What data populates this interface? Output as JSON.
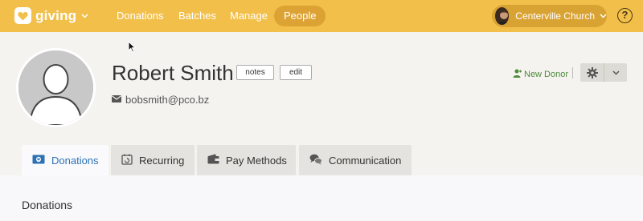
{
  "app": {
    "name": "giving"
  },
  "nav": {
    "items": [
      {
        "label": "Donations",
        "active": false
      },
      {
        "label": "Batches",
        "active": false
      },
      {
        "label": "Manage",
        "active": false
      },
      {
        "label": "People",
        "active": true
      }
    ]
  },
  "org": {
    "name": "Centerville Church"
  },
  "help": {
    "symbol": "?"
  },
  "person": {
    "name": "Robert Smith",
    "email": "bobsmith@pco.bz",
    "notes_label": "notes",
    "edit_label": "edit"
  },
  "actions": {
    "new_donor_label": "New Donor"
  },
  "tabs": [
    {
      "label": "Donations",
      "icon": "donations-icon",
      "active": true
    },
    {
      "label": "Recurring",
      "icon": "recurring-icon",
      "active": false
    },
    {
      "label": "Pay Methods",
      "icon": "wallet-icon",
      "active": false
    },
    {
      "label": "Communication",
      "icon": "chat-icon",
      "active": false
    }
  ],
  "content": {
    "section_title": "Donations"
  },
  "colors": {
    "topbar": "#f2bf4a",
    "nav_active": "#dca334",
    "link_blue": "#2d72b4",
    "donor_green": "#4f8a3a",
    "page_bg": "#f4f3f0"
  }
}
